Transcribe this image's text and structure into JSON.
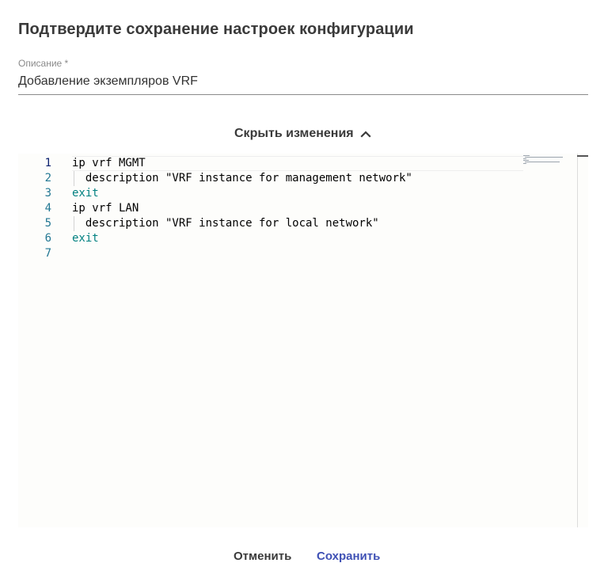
{
  "dialog": {
    "title": "Подтвердите сохранение настроек конфигурации"
  },
  "description_field": {
    "label": "Описание *",
    "value": "Добавление экземпляров VRF"
  },
  "changes_toggle": {
    "label": "Скрыть изменения",
    "icon": "chevron-up-icon"
  },
  "editor": {
    "line_numbers": [
      "1",
      "2",
      "3",
      "4",
      "5",
      "6",
      "7"
    ],
    "lines": [
      "ip vrf MGMT",
      "  description \"VRF instance for management network\"",
      "exit",
      "ip vrf LAN",
      "  description \"VRF instance for local network\"",
      "exit",
      ""
    ],
    "colors": {
      "line_number": "#237893",
      "active_line_number": "#0b216f",
      "keyword": "#008080",
      "text": "#000000",
      "background": "#fdfdfb"
    }
  },
  "actions": {
    "cancel_label": "Отменить",
    "save_label": "Сохранить",
    "accent_color": "#3f51b5"
  }
}
